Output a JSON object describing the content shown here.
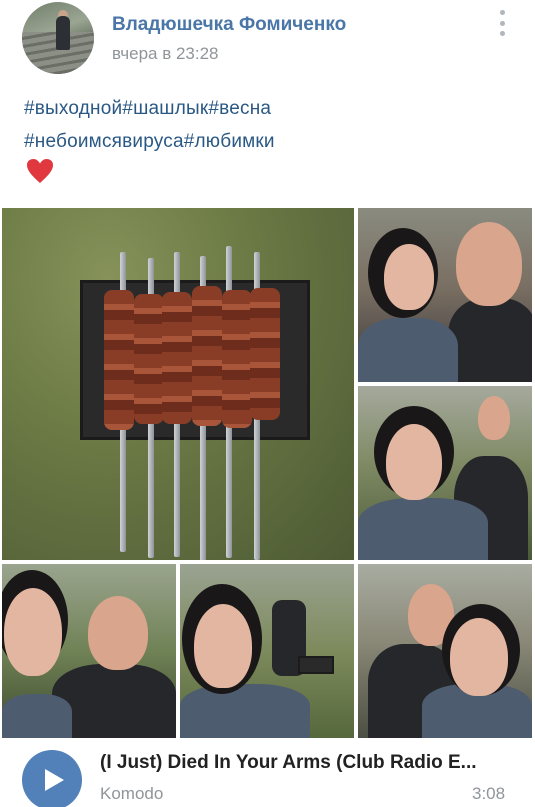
{
  "post": {
    "author": "Владюшечка Фомиченко",
    "time": "вчера в 23:28",
    "text_line1": "#выходной#шашлык#весна",
    "text_line2": "#небоимсявируса#любимки",
    "emoji": "heart-icon"
  },
  "photos": [
    "grill-skewers-photo",
    "couple-selfie-1",
    "couple-selfie-2",
    "couple-selfie-3",
    "woman-selfie-grill",
    "couple-selfie-4"
  ],
  "audio": {
    "title": "(I Just) Died In Your Arms (Club Radio E...",
    "artist": "Komodo",
    "duration": "3:08"
  },
  "colors": {
    "link": "#2a5885",
    "name": "#4a76a8",
    "meta": "#909599",
    "play": "#5181b8",
    "heart": "#e0383e"
  }
}
